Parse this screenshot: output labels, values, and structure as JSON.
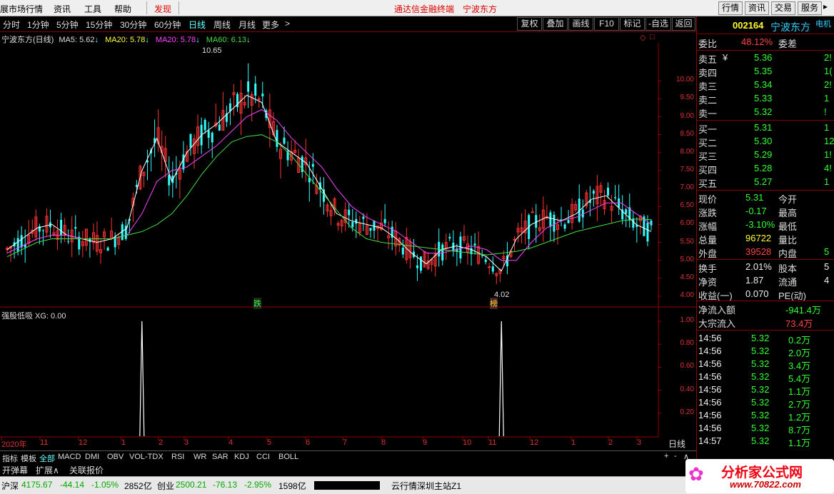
{
  "menubar": {
    "items": [
      "展市场行情",
      "资讯",
      "工具",
      "帮助",
      "发现"
    ],
    "center_title": "通达信金融终端",
    "stock_name": "宁波东方",
    "right_buttons": [
      "行情",
      "资讯",
      "交易",
      "服务"
    ]
  },
  "toolbar": {
    "periods": [
      "分时",
      "1分钟",
      "5分钟",
      "15分钟",
      "30分钟",
      "60分钟",
      "日线",
      "周线",
      "月线",
      "更多",
      ">"
    ],
    "active_period": "日线",
    "buttons": [
      "复权",
      "叠加",
      "画线",
      "F10",
      "标记",
      "-自选",
      "返回"
    ]
  },
  "chart_header": {
    "name": "宁波东方(日线)",
    "ma5": "MA5: 5.62",
    "ma20a": "MA20: 5.78",
    "ma20b": "MA20: 5.78",
    "ma60": "MA60: 6.13"
  },
  "chart_data": [
    {
      "type": "candlestick",
      "title": "宁波东方(日线)",
      "high_label": "10.65",
      "low_label": "4.02",
      "ylim": [
        3.8,
        10.9
      ],
      "y_ticks": [
        "10.00",
        "9.50",
        "9.00",
        "8.50",
        "8.00",
        "7.50",
        "7.00",
        "6.50",
        "6.00",
        "5.50",
        "5.00",
        "4.50",
        "4.00"
      ],
      "x_ticks": [
        "2020年",
        "11",
        "12",
        "1",
        "2",
        "3",
        "4",
        "5",
        "6",
        "7",
        "8",
        "9",
        "10",
        "11",
        "12",
        "1",
        "2",
        "3"
      ],
      "markers": [
        "跌",
        "榜"
      ],
      "series": [
        {
          "name": "MA5",
          "color": "#ffffff",
          "values": [
            5.3,
            5.6,
            5.9,
            6.0,
            5.7,
            5.6,
            5.5,
            5.6,
            5.9,
            7.5,
            8.4,
            7.2,
            8.0,
            8.5,
            8.8,
            9.2,
            9.6,
            9.4,
            8.3,
            8.0,
            7.7,
            7.0,
            6.3,
            6.1,
            6.0,
            5.9,
            5.6,
            5.2,
            4.9,
            5.3,
            5.4,
            5.3,
            5.1,
            4.7,
            5.6,
            6.0,
            6.2,
            6.1,
            6.3,
            6.7,
            6.8,
            6.4,
            6.0,
            5.8
          ]
        },
        {
          "name": "MA20",
          "color": "#ff44ff",
          "values": [
            5.2,
            5.4,
            5.6,
            5.7,
            5.7,
            5.6,
            5.6,
            5.6,
            5.7,
            6.3,
            7.2,
            7.5,
            7.6,
            7.9,
            8.2,
            8.6,
            9.0,
            9.2,
            8.9,
            8.4,
            8.0,
            7.6,
            7.0,
            6.5,
            6.2,
            6.0,
            5.8,
            5.5,
            5.2,
            5.2,
            5.3,
            5.4,
            5.3,
            5.0,
            5.0,
            5.5,
            5.9,
            6.1,
            6.2,
            6.4,
            6.6,
            6.6,
            6.3,
            6.0
          ]
        },
        {
          "name": "MA60",
          "color": "#44dd44",
          "values": [
            5.1,
            5.3,
            5.5,
            5.6,
            5.6,
            5.6,
            5.6,
            5.6,
            5.7,
            5.8,
            6.0,
            6.3,
            6.8,
            7.4,
            7.9,
            8.3,
            8.45,
            8.5,
            8.3,
            7.9,
            7.4,
            6.9,
            6.4,
            5.9,
            5.6,
            5.5,
            5.45,
            5.4,
            5.35,
            5.3,
            5.25,
            5.2,
            5.15,
            5.2,
            5.25,
            5.35,
            5.5,
            5.65,
            5.8,
            5.9,
            6.0,
            6.1,
            6.15,
            6.13
          ]
        }
      ]
    },
    {
      "type": "line",
      "title": "强股低吸 XG: 0.00",
      "ylim": [
        0,
        1.0
      ],
      "y_ticks": [
        "1.00",
        "0.80",
        "0.60",
        "0.40",
        "0.20"
      ],
      "signals": [
        {
          "x_index": 9,
          "value": 1.0
        },
        {
          "x_index": 33,
          "value": 1.0
        }
      ]
    }
  ],
  "axis_period_label": "日线",
  "right_panel": {
    "code": "002164",
    "name": "宁波东方",
    "sub": "电机",
    "weibi_label": "委比",
    "weibi": "48.12%",
    "weicha_label": "委差",
    "asks": [
      {
        "label": "卖五",
        "price": "5.36",
        "vol": "2!"
      },
      {
        "label": "卖四",
        "price": "5.35",
        "vol": "1("
      },
      {
        "label": "卖三",
        "price": "5.34",
        "vol": "2!"
      },
      {
        "label": "卖二",
        "price": "5.33",
        "vol": "1"
      },
      {
        "label": "卖一",
        "price": "5.32",
        "vol": "!"
      }
    ],
    "bids": [
      {
        "label": "买一",
        "price": "5.31",
        "vol": "1"
      },
      {
        "label": "买二",
        "price": "5.30",
        "vol": "12!"
      },
      {
        "label": "买三",
        "price": "5.29",
        "vol": "1!"
      },
      {
        "label": "买四",
        "price": "5.28",
        "vol": "4!"
      },
      {
        "label": "买五",
        "price": "5.27",
        "vol": "1"
      }
    ],
    "stats": [
      {
        "l": "现价",
        "v": "5.31",
        "r": "今开",
        "cls": "g"
      },
      {
        "l": "涨跌",
        "v": "-0.17",
        "r": "最高",
        "cls": "g"
      },
      {
        "l": "涨幅",
        "v": "-3.10%",
        "r": "最低",
        "cls": "g"
      },
      {
        "l": "总量",
        "v": "96722",
        "r": "量比",
        "cls": "y"
      },
      {
        "l": "外盘",
        "v": "39528",
        "r": "内盘",
        "cls": "r",
        "extra": "5"
      }
    ],
    "stats2": [
      {
        "l": "换手",
        "v": "2.01%",
        "r": "股本",
        "extra": "5"
      },
      {
        "l": "净资",
        "v": "1.87",
        "r": "流通",
        "extra": "4"
      },
      {
        "l": "收益(一)",
        "v": "0.070",
        "r": "PE(动)"
      }
    ],
    "flow": [
      {
        "l": "净流入额",
        "v": "-941.4万",
        "cls": "g"
      },
      {
        "l": "大宗流入",
        "v": "73.4万",
        "cls": "r"
      }
    ],
    "ticks": [
      {
        "t": "14:56",
        "p": "5.32",
        "v": "0.2万"
      },
      {
        "t": "14:56",
        "p": "5.32",
        "v": "2.0万"
      },
      {
        "t": "14:56",
        "p": "5.32",
        "v": "3.4万"
      },
      {
        "t": "14:56",
        "p": "5.32",
        "v": "5.4万"
      },
      {
        "t": "14:56",
        "p": "5.32",
        "v": "1.1万"
      },
      {
        "t": "14:56",
        "p": "5.32",
        "v": "2.7万"
      },
      {
        "t": "14:56",
        "p": "5.32",
        "v": "1.2万"
      },
      {
        "t": "14:56",
        "p": "5.32",
        "v": "8.7万"
      },
      {
        "t": "14:57",
        "p": "5.32",
        "v": "1.1万"
      }
    ]
  },
  "bottom_tabs": [
    "指标",
    "模板",
    "全部",
    "MACD",
    "DMI",
    "OBV",
    "VOL-TDX",
    "RSI",
    "WR",
    "SAR",
    "KDJ",
    "CCI",
    "BOLL"
  ],
  "bottom_tabs2": [
    "开弹幕",
    "扩展∧",
    "关联报价"
  ],
  "status": {
    "sh_label": "沪深",
    "sh_val": "4175.67",
    "sh_chg": "-44.14",
    "sh_pct": "-1.05%",
    "sh_amt": "2852亿",
    "cy_label": "创业",
    "cy_val": "2500.21",
    "cy_chg": "-76.13",
    "cy_pct": "-2.95%",
    "cy_amt": "1598亿",
    "server": "云行情深圳主站Z1",
    "watermark": "分析家公式网",
    "watermark_url": "www.70822.com"
  }
}
